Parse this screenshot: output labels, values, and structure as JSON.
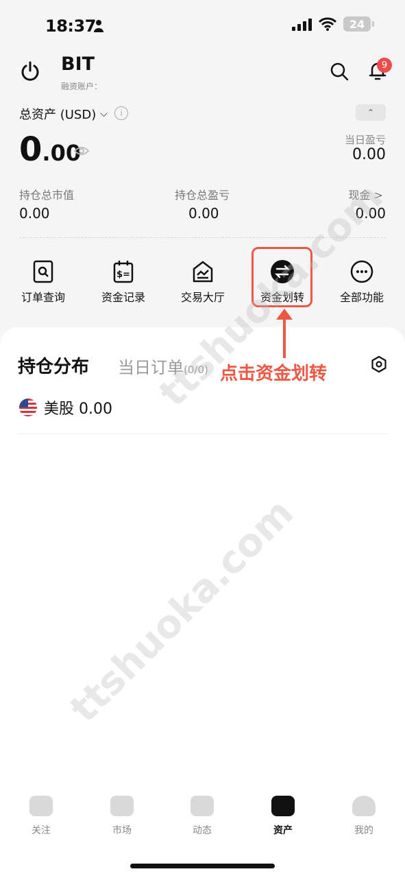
{
  "status": {
    "time": "18:37",
    "battery": "24"
  },
  "header": {
    "account_name": "BIT",
    "account_sub": "融资账户：",
    "notification_count": "9"
  },
  "summary": {
    "total_label": "总资产 (USD)",
    "total_int": "0",
    "total_dec": ".00",
    "day_pl_label": "当日盈亏",
    "day_pl_value": "0.00",
    "market_value_label": "持仓总市值",
    "market_value": "0.00",
    "position_pl_label": "持仓总盈亏",
    "position_pl": "0.00",
    "cash_label": "现金 >",
    "cash_value": "0.00"
  },
  "actions": [
    {
      "label": "订单查询",
      "icon": "order-search-icon"
    },
    {
      "label": "资金记录",
      "icon": "fund-record-icon"
    },
    {
      "label": "交易大厅",
      "icon": "trading-hall-icon"
    },
    {
      "label": "资金划转",
      "icon": "transfer-icon"
    },
    {
      "label": "全部功能",
      "icon": "more-icon"
    }
  ],
  "annotation": {
    "text": "点击资金划转",
    "color": "#ef5745"
  },
  "positions": {
    "tab_active": "持仓分布",
    "tab_inactive": "当日订单",
    "tab_inactive_count": "(0/0)",
    "us_stock_label": "美股 0.00"
  },
  "nav": [
    {
      "label": "关注",
      "icon": "watchlist-icon"
    },
    {
      "label": "市场",
      "icon": "market-icon"
    },
    {
      "label": "动态",
      "icon": "feed-icon"
    },
    {
      "label": "资产",
      "icon": "assets-icon"
    },
    {
      "label": "我的",
      "icon": "profile-icon"
    }
  ],
  "watermark": "ttshuoka.com"
}
